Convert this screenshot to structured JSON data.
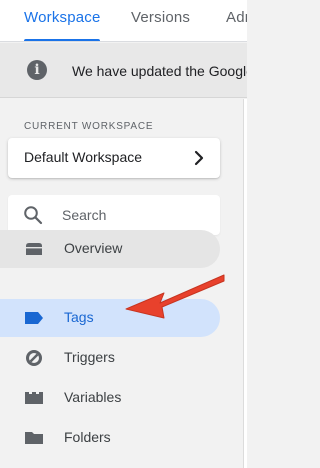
{
  "tabs": [
    {
      "label": "Workspace",
      "active": true
    },
    {
      "label": "Versions",
      "active": false
    },
    {
      "label": "Adm",
      "active": false
    }
  ],
  "notice": {
    "icon": "info-icon",
    "glyph": "i",
    "text": "We have updated the Google"
  },
  "workspace": {
    "section_label": "CURRENT WORKSPACE",
    "name": "Default Workspace",
    "chevron_icon": "chevron-right-icon"
  },
  "search": {
    "icon": "search-icon",
    "placeholder": "Search",
    "value": ""
  },
  "nav": {
    "items": [
      {
        "label": "Overview",
        "icon": "overview-icon",
        "state": "hover"
      },
      {
        "label": "Tags",
        "icon": "tag-icon",
        "state": "active"
      },
      {
        "label": "Triggers",
        "icon": "triggers-icon",
        "state": "normal"
      },
      {
        "label": "Variables",
        "icon": "variables-icon",
        "state": "normal"
      },
      {
        "label": "Folders",
        "icon": "folder-icon",
        "state": "normal"
      }
    ]
  },
  "annotation": {
    "icon": "red-arrow-pointing-left",
    "color": "#e8412c"
  },
  "colors": {
    "accent": "#1a73e8",
    "active_nav_bg": "#d2e3fc",
    "active_nav_text": "#1967d2",
    "icon_gray": "#5f6368"
  }
}
